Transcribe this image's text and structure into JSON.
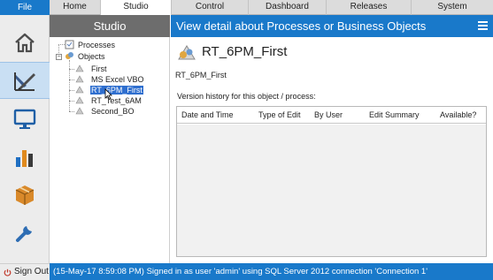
{
  "topbar": {
    "file_label": "File",
    "tabs": [
      {
        "label": "Home"
      },
      {
        "label": "Studio"
      },
      {
        "label": "Control"
      },
      {
        "label": "Dashboard"
      },
      {
        "label": "Releases"
      },
      {
        "label": "System"
      }
    ],
    "active_tab": "Studio"
  },
  "leftnav": {
    "items": [
      {
        "icon": "home-icon"
      },
      {
        "icon": "studio-edit-icon",
        "active": true
      },
      {
        "icon": "monitor-icon"
      },
      {
        "icon": "bar-chart-icon"
      },
      {
        "icon": "package-icon"
      },
      {
        "icon": "wrench-icon"
      }
    ],
    "signout_label": "Sign Out"
  },
  "studio": {
    "title": "Studio",
    "tree": {
      "processes_label": "Processes",
      "objects_label": "Objects",
      "objects": [
        "First",
        "MS Excel VBO",
        "RT_6PM_First",
        "RT_Test_6AM",
        "Second_BO"
      ],
      "selected": "RT_6PM_First"
    }
  },
  "detail": {
    "header": "View detail about Processes or Business Objects",
    "object_title": "RT_6PM_First",
    "object_subtitle": "RT_6PM_First",
    "history_label": "Version history for this object / process:",
    "columns": [
      "Date and Time",
      "Type of Edit",
      "By User",
      "Edit Summary",
      "Available?"
    ],
    "rows": []
  },
  "statusbar": {
    "text": "(15-May-17 8:59:08 PM) Signed in as user 'admin' using SQL Server 2012 connection 'Connection 1'"
  },
  "colors": {
    "accent_blue": "#1979ca",
    "studio_header_gray": "#6d6d6d",
    "selection_blue": "#2f6fcf"
  }
}
